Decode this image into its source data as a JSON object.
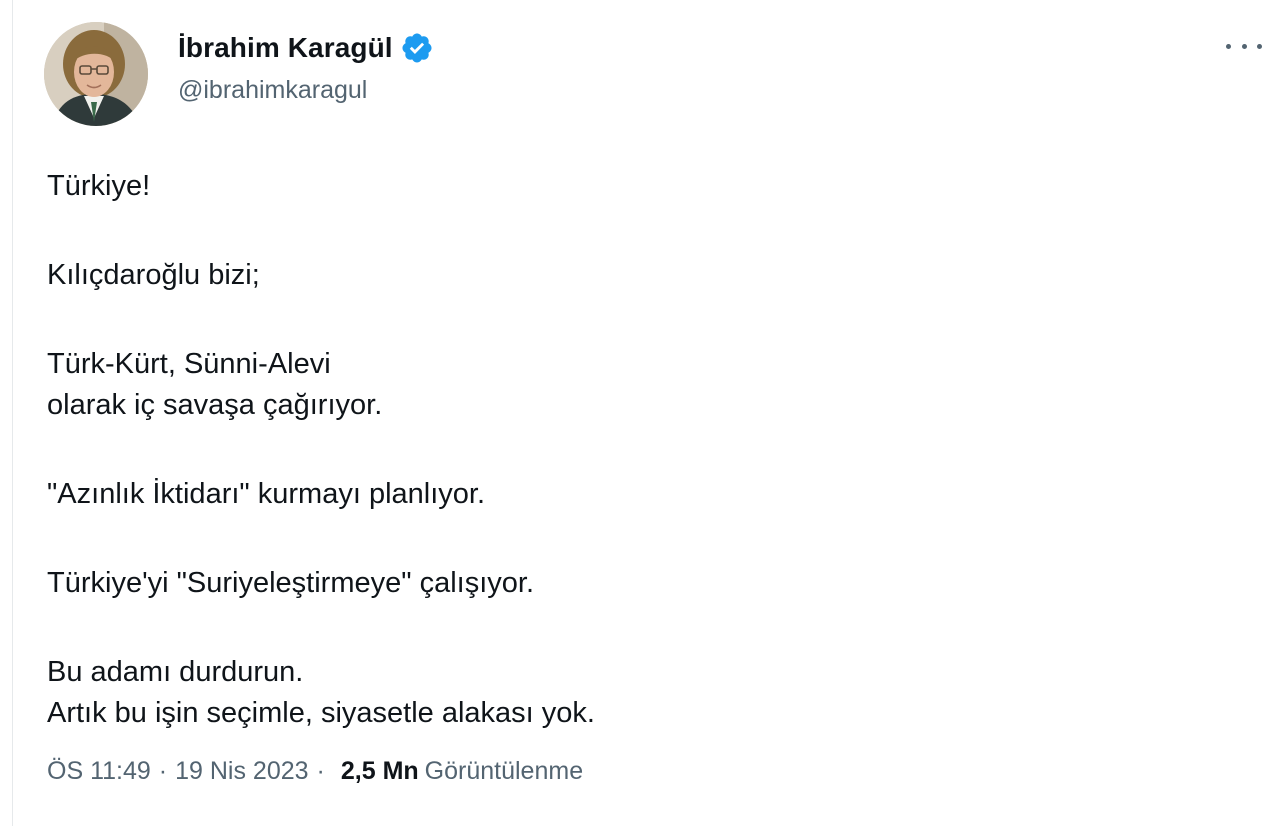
{
  "author": {
    "display_name": "İbrahim Karagül",
    "handle": "@ibrahimkaragul",
    "verified": true
  },
  "tweet": {
    "paragraphs": [
      [
        "Türkiye!"
      ],
      [
        "Kılıçdaroğlu bizi;"
      ],
      [
        "Türk-Kürt, Sünni-Alevi",
        "olarak iç savaşa çağırıyor."
      ],
      [
        "\"Azınlık İktidarı\" kurmayı planlıyor."
      ],
      [
        "Türkiye'yi \"Suriyeleştirmeye\" çalışıyor."
      ],
      [
        "Bu adamı durdurun.",
        "Artık bu işin seçimle, siyasetle alakası yok."
      ]
    ]
  },
  "meta": {
    "time": "ÖS 11:49",
    "separator": "·",
    "date": "19 Nis 2023",
    "views_count": "2,5 Mn",
    "views_label": "Görüntülenme"
  },
  "icons": {
    "verified_badge": "verified-badge-icon",
    "more": "more-horizontal-icon"
  },
  "colors": {
    "text_primary": "#0f1419",
    "text_secondary": "#536471",
    "verified_blue": "#1d9bf0"
  }
}
